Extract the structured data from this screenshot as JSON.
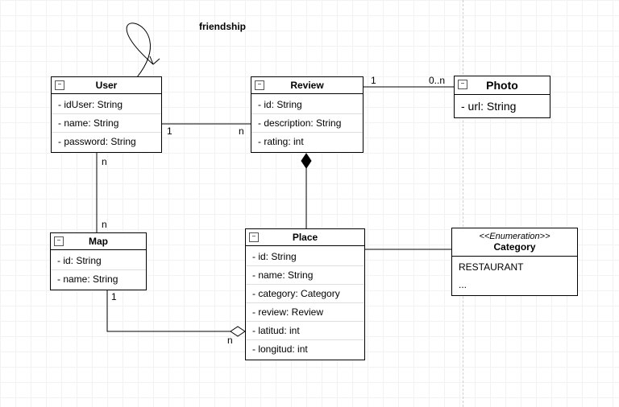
{
  "labels": {
    "friendship": "friendship",
    "user_review_left": "1",
    "user_review_right": "n",
    "review_photo_left": "1",
    "review_photo_right": "0..n",
    "user_map_top": "n",
    "user_map_bottom": "n",
    "map_place_left": "1",
    "map_place_right": "n"
  },
  "classes": {
    "user": {
      "name": "User",
      "attrs": [
        "- idUser: String",
        "- name: String",
        "- password: String"
      ]
    },
    "review": {
      "name": "Review",
      "attrs": [
        "- id: String",
        "- description: String",
        "- rating: int"
      ]
    },
    "photo": {
      "name": "Photo",
      "attrs": [
        "- url: String"
      ]
    },
    "map": {
      "name": "Map",
      "attrs": [
        "- id: String",
        "- name: String"
      ]
    },
    "place": {
      "name": "Place",
      "attrs": [
        "- id: String",
        "- name: String",
        "- category: Category",
        "- review: Review",
        "- latitud: int",
        "- longitud: int"
      ]
    },
    "category": {
      "stereotype": "<<Enumeration>>",
      "name": "Category",
      "literals": [
        "RESTAURANT",
        "..."
      ]
    }
  }
}
